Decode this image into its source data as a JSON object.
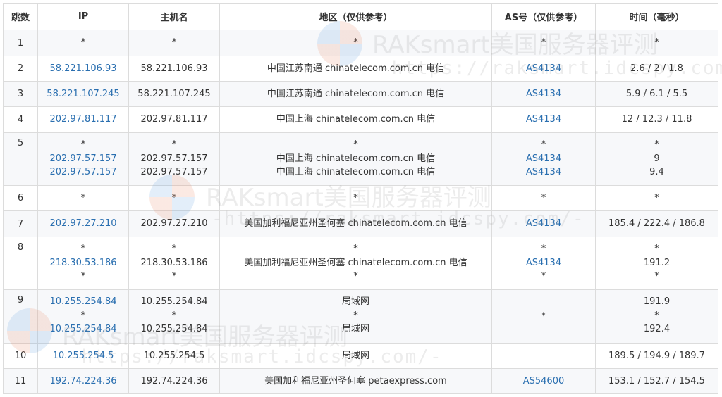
{
  "headers": {
    "hop": "跳数",
    "ip": "IP",
    "host": "主机名",
    "region": "地区（仅供参考）",
    "as": "AS号（仅供参考）",
    "time": "时间（毫秒）"
  },
  "rows": [
    {
      "hop": "1",
      "ip": [
        "*"
      ],
      "host": [
        "*"
      ],
      "region": [
        "*"
      ],
      "as": [
        "*"
      ],
      "time": [
        "*"
      ]
    },
    {
      "hop": "2",
      "ip": [
        "58.221.106.93"
      ],
      "host": [
        "58.221.106.93"
      ],
      "region": [
        "中国江苏南通 chinatelecom.com.cn 电信"
      ],
      "as": [
        "AS4134"
      ],
      "time": [
        "2.6 / 2 / 1.8"
      ]
    },
    {
      "hop": "3",
      "ip": [
        "58.221.107.245"
      ],
      "host": [
        "58.221.107.245"
      ],
      "region": [
        "中国江苏南通 chinatelecom.com.cn 电信"
      ],
      "as": [
        "AS4134"
      ],
      "time": [
        "5.9 / 6.1 / 5.5"
      ]
    },
    {
      "hop": "4",
      "ip": [
        "202.97.81.117"
      ],
      "host": [
        "202.97.81.117"
      ],
      "region": [
        "中国上海 chinatelecom.com.cn 电信"
      ],
      "as": [
        "AS4134"
      ],
      "time": [
        "12 / 12.3 / 11.8"
      ]
    },
    {
      "hop": "5",
      "ip": [
        "*",
        "202.97.57.157",
        "202.97.57.157"
      ],
      "host": [
        "*",
        "202.97.57.157",
        "202.97.57.157"
      ],
      "region": [
        "*",
        "中国上海 chinatelecom.com.cn 电信",
        "中国上海 chinatelecom.com.cn 电信"
      ],
      "as": [
        "*",
        "AS4134",
        "AS4134"
      ],
      "time": [
        "*",
        "9",
        "9.4"
      ]
    },
    {
      "hop": "6",
      "ip": [
        "*"
      ],
      "host": [
        "*"
      ],
      "region": [
        "*"
      ],
      "as": [
        "*"
      ],
      "time": [
        "*"
      ]
    },
    {
      "hop": "7",
      "ip": [
        "202.97.27.210"
      ],
      "host": [
        "202.97.27.210"
      ],
      "region": [
        "美国加利福尼亚州圣何塞 chinatelecom.com.cn 电信"
      ],
      "as": [
        "AS4134"
      ],
      "time": [
        "185.4 / 222.4 / 186.8"
      ]
    },
    {
      "hop": "8",
      "ip": [
        "*",
        "218.30.53.186",
        "*"
      ],
      "host": [
        "*",
        "218.30.53.186",
        "*"
      ],
      "region": [
        "*",
        "美国加利福尼亚州圣何塞 chinatelecom.com.cn 电信",
        "*"
      ],
      "as": [
        "*",
        "AS4134",
        "*"
      ],
      "time": [
        "*",
        "191.2",
        "*"
      ]
    },
    {
      "hop": "9",
      "ip": [
        "10.255.254.84",
        "*",
        "10.255.254.84"
      ],
      "host": [
        "10.255.254.84",
        "*",
        "10.255.254.84"
      ],
      "region": [
        "局域网",
        "*",
        "局域网"
      ],
      "as": [
        "*"
      ],
      "time": [
        "191.9",
        "*",
        "192.4"
      ]
    },
    {
      "hop": "10",
      "ip": [
        "10.255.254.5"
      ],
      "host": [
        "10.255.254.5"
      ],
      "region": [
        "局域网"
      ],
      "as": [
        ""
      ],
      "time": [
        "189.5 / 194.9 / 189.7"
      ]
    },
    {
      "hop": "11",
      "ip": [
        "192.74.224.36"
      ],
      "host": [
        "192.74.224.36"
      ],
      "region": [
        "美国加利福尼亚州圣何塞 petaexpress.com"
      ],
      "as": [
        "AS54600"
      ],
      "time": [
        "153.1 / 152.7 / 154.5"
      ]
    }
  ],
  "watermark": {
    "title": "RAKsmart美国服务器评测",
    "url": "-https://raksmart.idcspy.com/-"
  },
  "colors": {
    "link": "#2a6fb0",
    "border": "#dcdcdc",
    "stripe": "#f7f8fa"
  }
}
